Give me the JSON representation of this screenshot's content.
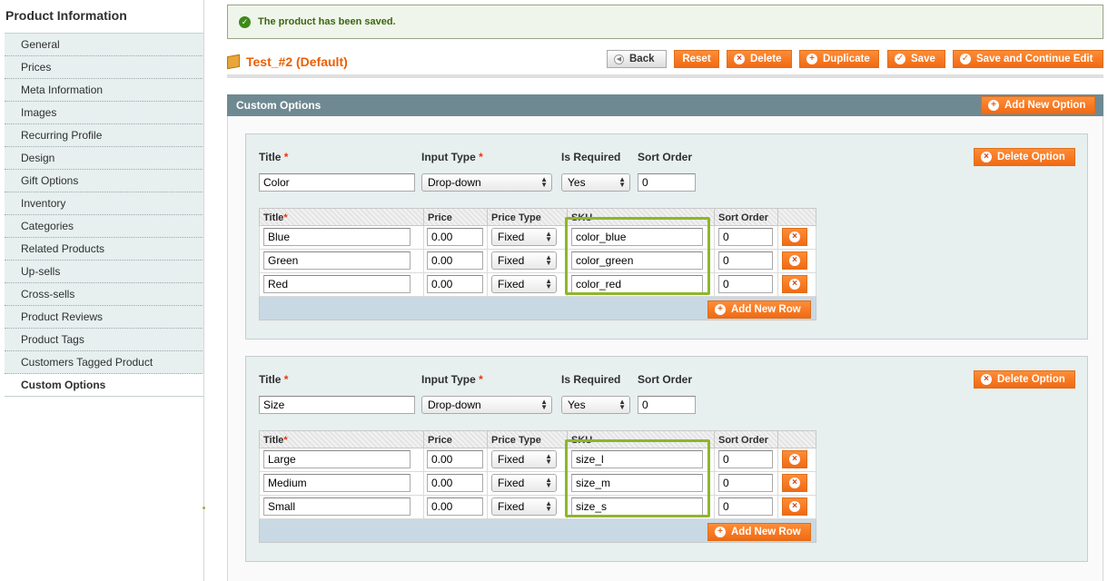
{
  "sidebar": {
    "title": "Product Information",
    "items": [
      {
        "label": "General"
      },
      {
        "label": "Prices"
      },
      {
        "label": "Meta Information"
      },
      {
        "label": "Images"
      },
      {
        "label": "Recurring Profile"
      },
      {
        "label": "Design"
      },
      {
        "label": "Gift Options"
      },
      {
        "label": "Inventory"
      },
      {
        "label": "Categories"
      },
      {
        "label": "Related Products"
      },
      {
        "label": "Up-sells"
      },
      {
        "label": "Cross-sells"
      },
      {
        "label": "Product Reviews"
      },
      {
        "label": "Product Tags"
      },
      {
        "label": "Customers Tagged Product"
      },
      {
        "label": "Custom Options",
        "active": true
      }
    ]
  },
  "message": "The product has been saved.",
  "page_title": "Test_#2 (Default)",
  "toolbar": {
    "back": "Back",
    "reset": "Reset",
    "delete": "Delete",
    "duplicate": "Duplicate",
    "save": "Save",
    "save_continue": "Save and Continue Edit"
  },
  "section": {
    "title": "Custom Options",
    "add_option": "Add New Option"
  },
  "labels": {
    "title": "Title",
    "required_mark": "*",
    "input_type": "Input Type",
    "is_required": "Is Required",
    "sort_order": "Sort Order",
    "delete_option": "Delete Option",
    "add_row": "Add New Row",
    "col_title": "Title",
    "col_price": "Price",
    "col_price_type": "Price Type",
    "col_sku": "SKU",
    "col_sort": "Sort Order"
  },
  "options": [
    {
      "title": "Color",
      "input_type": "Drop-down",
      "is_required": "Yes",
      "sort_order": "0",
      "rows": [
        {
          "title": "Blue",
          "price": "0.00",
          "price_type": "Fixed",
          "sku": "color_blue",
          "sort": "0"
        },
        {
          "title": "Green",
          "price": "0.00",
          "price_type": "Fixed",
          "sku": "color_green",
          "sort": "0"
        },
        {
          "title": "Red",
          "price": "0.00",
          "price_type": "Fixed",
          "sku": "color_red",
          "sort": "0"
        }
      ]
    },
    {
      "title": "Size",
      "input_type": "Drop-down",
      "is_required": "Yes",
      "sort_order": "0",
      "rows": [
        {
          "title": "Large",
          "price": "0.00",
          "price_type": "Fixed",
          "sku": "size_l",
          "sort": "0"
        },
        {
          "title": "Medium",
          "price": "0.00",
          "price_type": "Fixed",
          "sku": "size_m",
          "sort": "0"
        },
        {
          "title": "Small",
          "price": "0.00",
          "price_type": "Fixed",
          "sku": "size_s",
          "sort": "0"
        }
      ]
    }
  ]
}
